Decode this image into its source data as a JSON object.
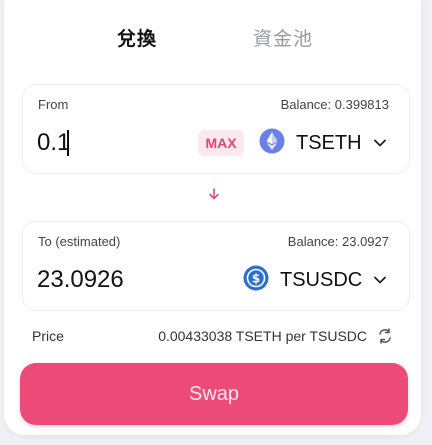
{
  "tabs": {
    "swap_label": "兌換",
    "pool_label": "資金池"
  },
  "from": {
    "label": "From",
    "balance": "Balance: 0.399813",
    "amount": "0.1",
    "max_label": "MAX",
    "token": "TSETH",
    "token_icon": "ethereum-icon"
  },
  "to": {
    "label": "To (estimated)",
    "balance": "Balance: 23.0927",
    "amount": "23.0926",
    "token": "TSUSDC",
    "token_icon": "usdc-icon"
  },
  "price": {
    "label": "Price",
    "value": "0.00433038 TSETH per TSUSDC"
  },
  "swap_button": "Swap",
  "colors": {
    "accent": "#ec4a78",
    "max_bg": "#fde8ef",
    "max_text": "#e0457b",
    "eth": "#6b7fe8",
    "usdc": "#2c6fd1"
  }
}
